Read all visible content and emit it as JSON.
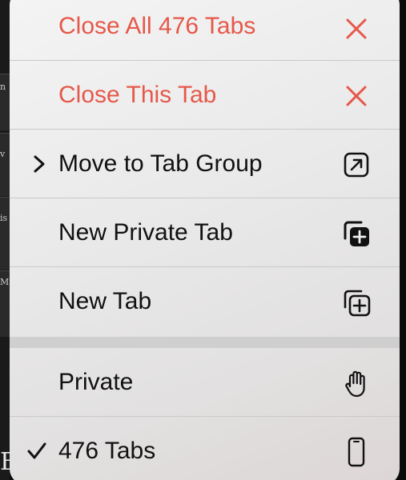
{
  "menu": {
    "items": [
      {
        "label": "Close All 476 Tabs",
        "icon": "close-icon",
        "color": "#e5584a"
      },
      {
        "label": "Close This Tab",
        "icon": "close-icon",
        "color": "#e5584a"
      },
      {
        "label": "Move to Tab Group",
        "icon": "arrow-up-right-square-icon",
        "lead": "chevron-right-icon"
      },
      {
        "label": "New Private Tab",
        "icon": "plus-square-on-square-filled-icon"
      },
      {
        "label": "New Tab",
        "icon": "plus-square-on-square-icon"
      }
    ],
    "groups": [
      {
        "label": "Private",
        "icon": "hand-raised-icon"
      },
      {
        "label": "476 Tabs",
        "icon": "iphone-icon",
        "selected": true
      }
    ]
  },
  "background": {
    "letters": [
      "n",
      "v",
      "is",
      "M",
      "B"
    ]
  }
}
